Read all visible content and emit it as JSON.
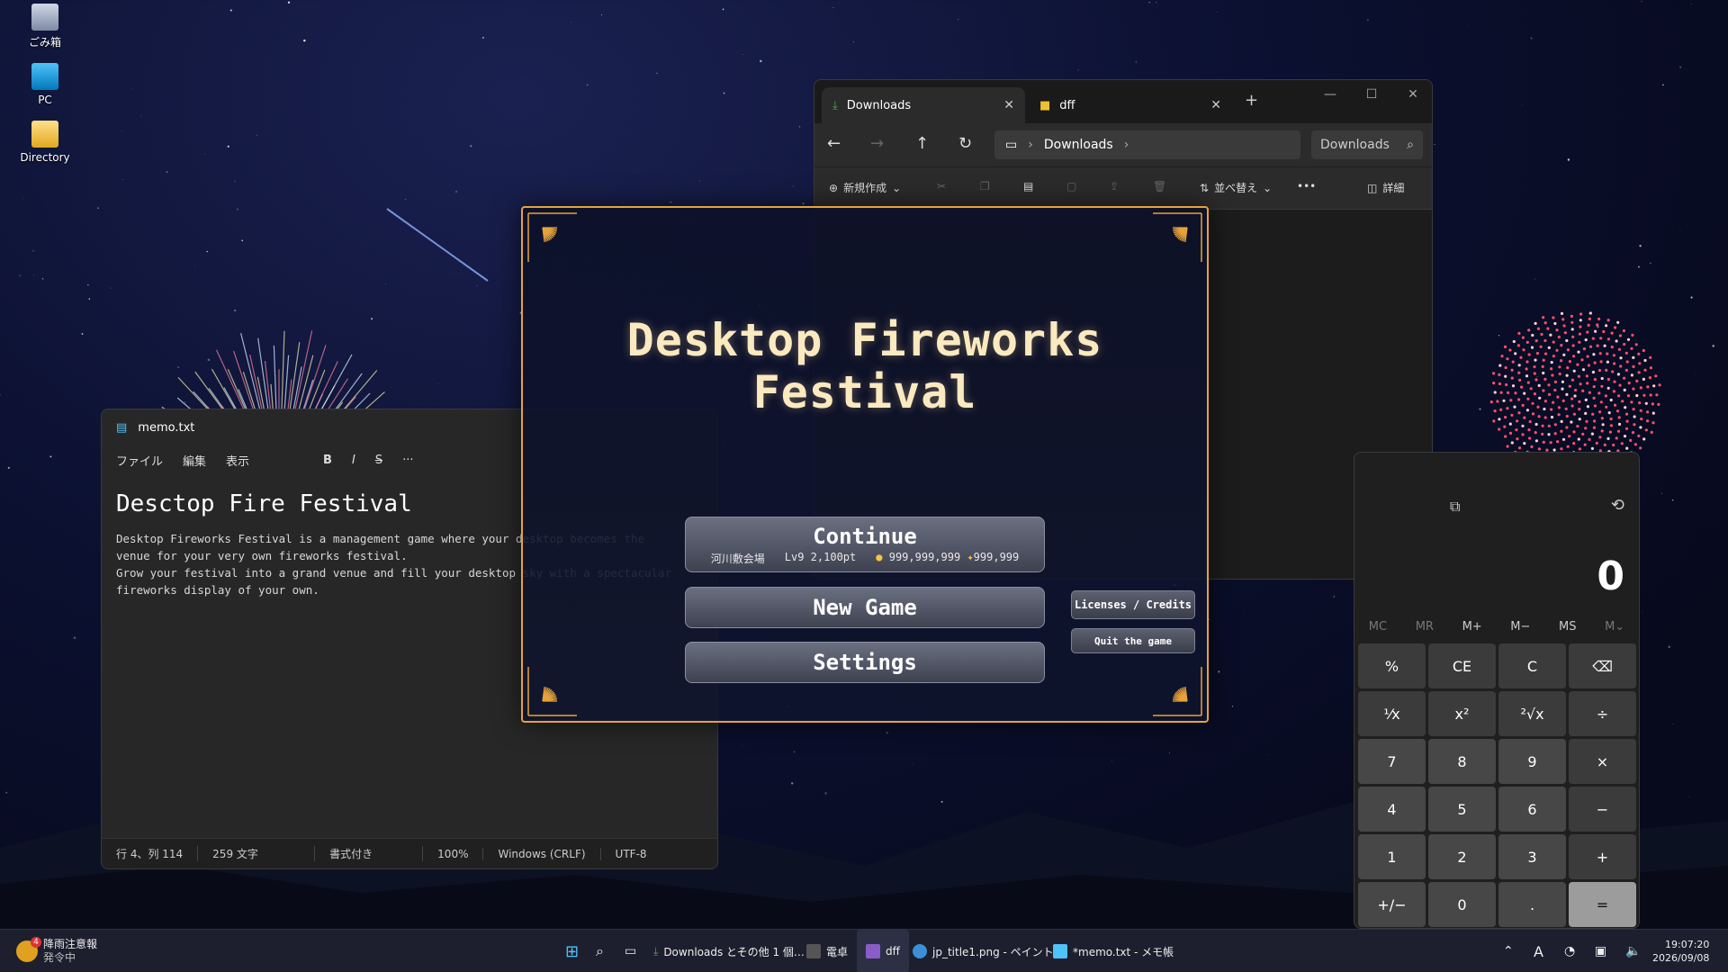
{
  "desktop": {
    "icons": [
      {
        "label": "ごみ箱",
        "icon": "recycle-bin-icon"
      },
      {
        "label": "PC",
        "icon": "monitor-icon"
      },
      {
        "label": "Directory",
        "icon": "folder-icon"
      }
    ]
  },
  "explorer": {
    "tabs": [
      {
        "label": "Downloads",
        "icon": "download-icon"
      },
      {
        "label": "dff",
        "icon": "folder-icon"
      }
    ],
    "address": {
      "crumb": "Downloads"
    },
    "search_placeholder": "Downloads",
    "commands": {
      "new": "新規作成",
      "sort": "並べ替え",
      "more": "•••",
      "details": "詳細"
    }
  },
  "notepad": {
    "title": "memo.txt",
    "menu": [
      "ファイル",
      "編集",
      "表示"
    ],
    "heading": "Desctop Fire Festival",
    "body": "Desktop Fireworks Festival is a management game where your desktop becomes the\nvenue for your very own fireworks festival.\nGrow your festival into a grand venue and fill your desktop sky with a spectacular\nfireworks display of your own.",
    "status": {
      "position": "行 4、列 114",
      "chars": "259 文字",
      "format": "書式付き",
      "zoom": "100%",
      "eol": "Windows (CRLF)",
      "encoding": "UTF-8"
    }
  },
  "calculator": {
    "display": "0",
    "memory": [
      "MC",
      "MR",
      "M+",
      "M−",
      "MS",
      "M⌄"
    ],
    "keys": [
      "%",
      "CE",
      "C",
      "⌫",
      "⅟x",
      "x²",
      "²√x",
      "÷",
      "7",
      "8",
      "9",
      "×",
      "4",
      "5",
      "6",
      "−",
      "1",
      "2",
      "3",
      "+",
      "+/−",
      "0",
      ".",
      "="
    ]
  },
  "game": {
    "title": "Desktop Fireworks Festival",
    "continue": {
      "label": "Continue",
      "venue": "河川敷会場",
      "level": "Lv9 2,100pt",
      "coins": "999,999,999",
      "stars": "999,999"
    },
    "new_game": "New Game",
    "settings": "Settings",
    "licenses": "Licenses / Credits",
    "quit": "Quit the game"
  },
  "taskbar": {
    "weather": {
      "title": "降雨注意報",
      "sub": "発令中",
      "badge": "4"
    },
    "apps": [
      {
        "label": "Downloads とその他 1 個…",
        "icon": "explorer-icon"
      },
      {
        "label": "電卓",
        "icon": "calculator-icon"
      },
      {
        "label": "dff",
        "icon": "game-icon"
      },
      {
        "label": "jp_title1.png - ペイント",
        "icon": "paint-icon"
      },
      {
        "label": "*memo.txt - メモ帳",
        "icon": "notepad-icon"
      }
    ],
    "ime": "A",
    "time": "19:07:20",
    "date": "2026/09/08"
  },
  "colors": {
    "accent": "#e6a33a",
    "title": "#fbe9c0"
  }
}
